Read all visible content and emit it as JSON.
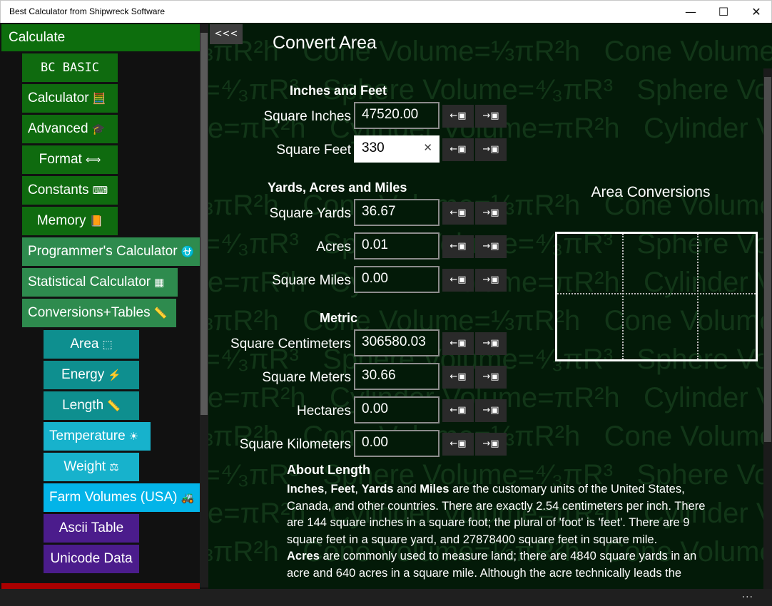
{
  "window": {
    "title": "Best Calculator from Shipwreck Software",
    "minimize": "—",
    "maximize": "☐",
    "close": "✕"
  },
  "sidebar": {
    "header": "Calculate",
    "items": [
      {
        "label": "BC BASIC",
        "icon": ""
      },
      {
        "label": "Calculator",
        "icon": "🧮"
      },
      {
        "label": "Advanced",
        "icon": "🎓"
      },
      {
        "label": "Format",
        "icon": "⟺"
      },
      {
        "label": "Constants",
        "icon": "⌨"
      },
      {
        "label": "Memory",
        "icon": "📙"
      },
      {
        "label": "Programmer's Calculator",
        "icon": "⛎"
      },
      {
        "label": "Statistical Calculator",
        "icon": "▦"
      },
      {
        "label": "Conversions+Tables",
        "icon": "📏"
      },
      {
        "label": "Area",
        "icon": "⬚"
      },
      {
        "label": "Energy",
        "icon": "⚡"
      },
      {
        "label": "Length",
        "icon": "📏"
      },
      {
        "label": "Temperature",
        "icon": "☀"
      },
      {
        "label": "Weight",
        "icon": "⚖"
      },
      {
        "label": "Farm Volumes (USA)",
        "icon": "🚜"
      },
      {
        "label": "Ascii Table",
        "icon": ""
      },
      {
        "label": "Unicode Data",
        "icon": ""
      }
    ]
  },
  "background_text": {
    "cone": "Cone Volume=⅓πR²h",
    "sphere": "Sphere Volume=⁴⁄₃πR³",
    "cylinder": "Cylinder Volume=πR²h"
  },
  "main": {
    "collapse": "<<<",
    "title": "Convert Area",
    "sections": {
      "imperial": "Inches and Feet",
      "yards": "Yards, Acres and Miles",
      "metric": "Metric"
    },
    "rows": [
      {
        "label": "Square Inches",
        "value": "47520.00"
      },
      {
        "label": "Square Feet",
        "value": "330"
      },
      {
        "label": "Square Yards",
        "value": "36.67"
      },
      {
        "label": "Acres",
        "value": "0.01"
      },
      {
        "label": "Square Miles",
        "value": "0.00"
      },
      {
        "label": "Square Centimeters",
        "value": "306580.03"
      },
      {
        "label": "Square Meters",
        "value": "30.66"
      },
      {
        "label": "Hectares",
        "value": "0.00"
      },
      {
        "label": "Square Kilometers",
        "value": "0.00"
      }
    ],
    "btn_left": "←▣",
    "btn_right": "→▣",
    "clear_glyph": "✕",
    "chart_title": "Area Conversions",
    "about_title": "About Length",
    "about": {
      "p1_b1": "Inches",
      "p1_b2": "Feet",
      "p1_b3": "Yards",
      "p1_b4": "Miles",
      "p1_rest": " are the customary units of the United States, Canada, and other countries. There are exactly 2.54 centimeters per inch. There are 144 square inches in a square foot; the plural of 'foot' is 'feet'. There are 9 square feet in a square yard, and 27878400 square feet in square mile.",
      "p2_b": "Acres",
      "p2_rest": " are commonly used to measure land; there are 4840 square yards in an acre and 640 acres in a square mile. Although the acre technically leads the"
    }
  },
  "bottom": {
    "more": "..."
  }
}
